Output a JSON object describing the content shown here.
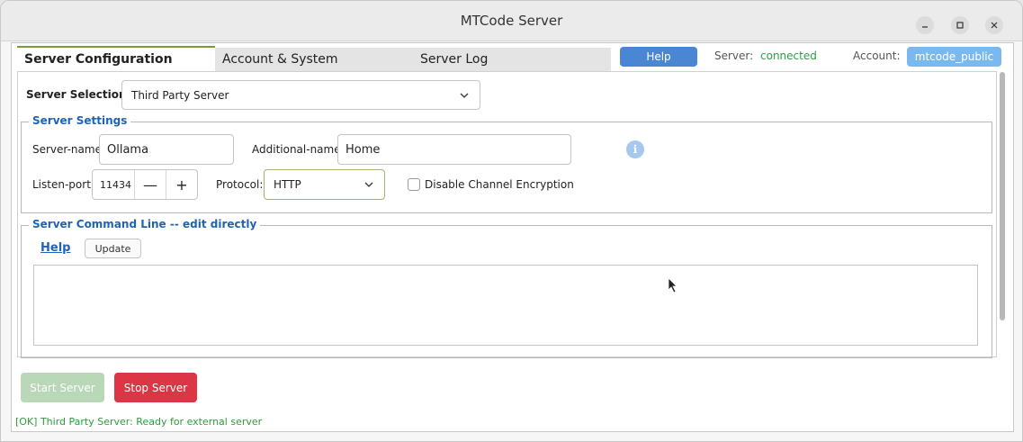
{
  "window": {
    "title": "MTCode Server"
  },
  "tabs": [
    {
      "label": "Server Configuration"
    },
    {
      "label": "Account & System"
    },
    {
      "label": "Server Log"
    }
  ],
  "header": {
    "help_label": "Help",
    "server_label": "Server:",
    "server_status": "connected",
    "account_label": "Account:",
    "account_value": "mtcode_public"
  },
  "server_selection": {
    "label": "Server Selection:",
    "value": "Third Party Server"
  },
  "server_settings": {
    "title": "Server Settings",
    "server_name_label": "Server-name:",
    "server_name_value": "Ollama",
    "additional_name_label": "Additional-name:",
    "additional_name_value": "Home",
    "listen_port_label": "Listen-port:",
    "listen_port_value": "11434",
    "minus": "—",
    "plus": "+",
    "protocol_label": "Protocol:",
    "protocol_value": "HTTP",
    "disable_encryption_label": "Disable Channel Encryption",
    "info": "i"
  },
  "command_line": {
    "title": "Server Command Line  --  edit directly",
    "help_link": "Help",
    "update_label": "Update"
  },
  "actions": {
    "start_label": "Start Server",
    "stop_label": "Stop Server"
  },
  "status": "[OK] Third Party Server: Ready for external server",
  "colors": {
    "accent": "#4a86d4",
    "connected": "#2ea044",
    "stop": "#dc3545",
    "start_disabled": "#b8d8b8"
  }
}
